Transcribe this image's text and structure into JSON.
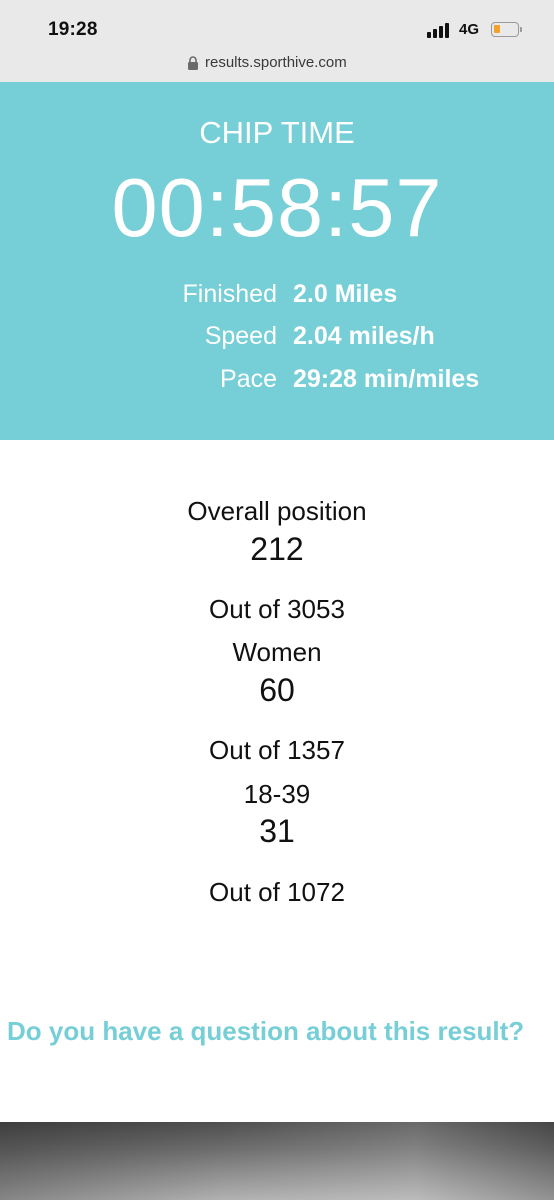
{
  "status_bar": {
    "time": "19:28",
    "network": "4G",
    "signal_icon": "cellular-signal-icon",
    "battery_icon": "battery-icon",
    "battery_color": "#f2a12b"
  },
  "url_bar": {
    "lock_icon": "lock-icon",
    "url": "results.sporthive.com"
  },
  "hero": {
    "background_color": "#76ced6",
    "label": "CHIP TIME",
    "time": "00:58:57",
    "stats": [
      {
        "label": "Finished",
        "value": "2.0 Miles"
      },
      {
        "label": "Speed",
        "value": "2.04 miles/h"
      },
      {
        "label": "Pace",
        "value": "29:28 min/miles"
      }
    ]
  },
  "positions": [
    {
      "label": "Overall position",
      "value": "212",
      "out_of": "Out of 3053"
    },
    {
      "label": "Women",
      "value": "60",
      "out_of": "Out of 1357"
    },
    {
      "label": "18-39",
      "value": "31",
      "out_of": "Out of 1072"
    }
  ],
  "question_link": "Do you have a question about this result?"
}
